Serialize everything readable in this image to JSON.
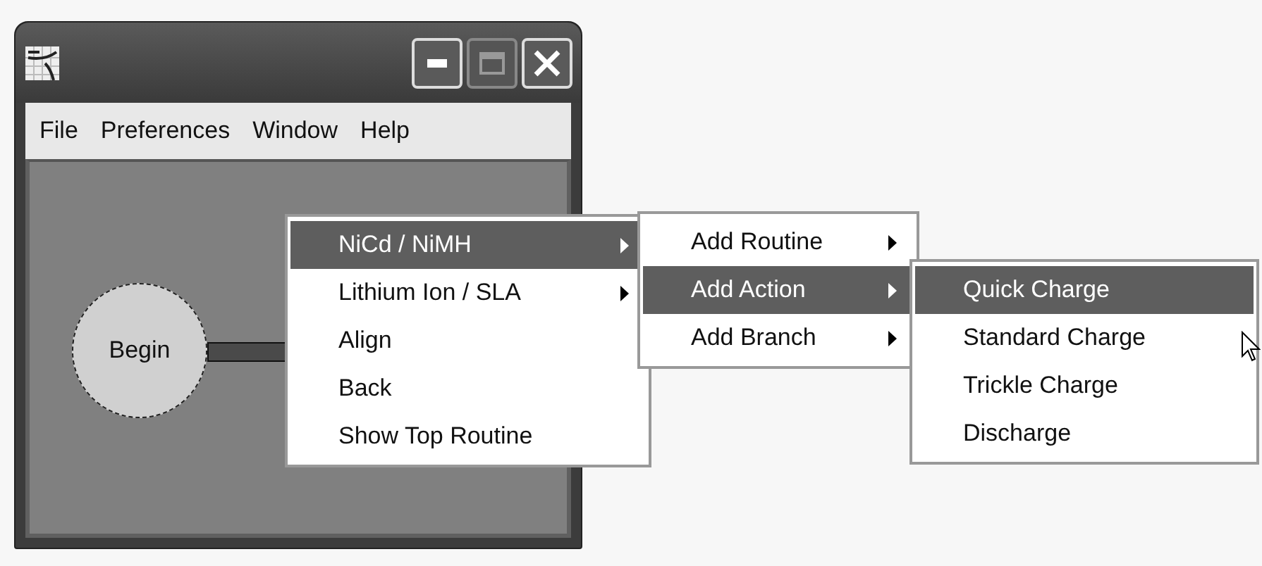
{
  "window": {
    "controls": [
      {
        "kind": "minimize",
        "disabled": false
      },
      {
        "kind": "maximize",
        "disabled": true
      },
      {
        "kind": "close",
        "disabled": false
      }
    ]
  },
  "menubar": [
    "File",
    "Preferences",
    "Window",
    "Help"
  ],
  "canvas": {
    "nodes": [
      {
        "label": "Begin"
      }
    ]
  },
  "menus": [
    {
      "items": [
        {
          "label": "NiCd / NiMH",
          "submenu": true,
          "selected": true
        },
        {
          "label": "Lithium Ion / SLA",
          "submenu": true,
          "selected": false
        },
        {
          "label": "Align",
          "submenu": false,
          "selected": false
        },
        {
          "label": "Back",
          "submenu": false,
          "selected": false
        },
        {
          "label": "Show Top Routine",
          "submenu": false,
          "selected": false
        }
      ]
    },
    {
      "items": [
        {
          "label": "Add Routine",
          "submenu": true,
          "selected": false
        },
        {
          "label": "Add Action",
          "submenu": true,
          "selected": true
        },
        {
          "label": "Add Branch",
          "submenu": true,
          "selected": false
        }
      ]
    },
    {
      "items": [
        {
          "label": "Quick Charge",
          "submenu": false,
          "selected": true
        },
        {
          "label": "Standard Charge",
          "submenu": false,
          "selected": false
        },
        {
          "label": "Trickle Charge",
          "submenu": false,
          "selected": false
        },
        {
          "label": "Discharge",
          "submenu": false,
          "selected": false
        }
      ]
    }
  ]
}
